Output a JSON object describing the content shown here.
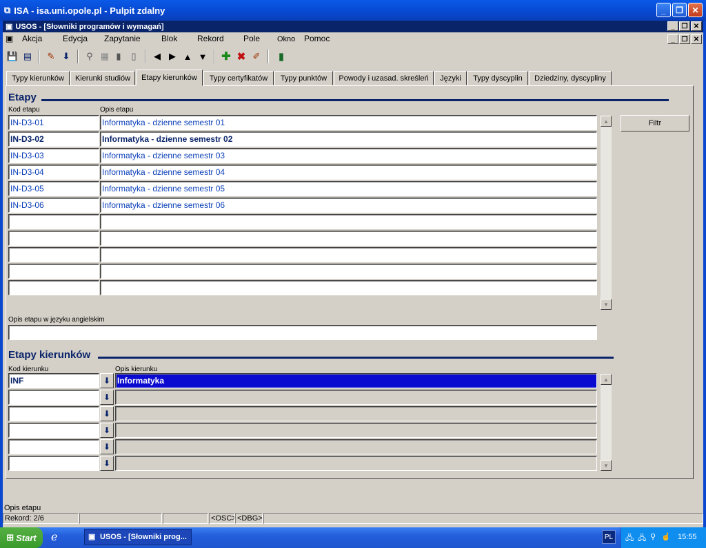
{
  "outer_window": {
    "title": "ISA - isa.uni.opole.pl - Pulpit zdalny"
  },
  "inner_window": {
    "title": "USOS - [Słowniki programów i wymagań]"
  },
  "menu": [
    "Akcja",
    "Edycja",
    "Zapytanie",
    "Blok",
    "Rekord",
    "Pole",
    "Okno",
    "Pomoc"
  ],
  "tabs": [
    "Typy kierunków",
    "Kierunki studiów",
    "Etapy kierunków",
    "Typy certyfikatów",
    "Typy punktów",
    "Powody i uzasad. skreśleń",
    "Języki",
    "Typy dyscyplin",
    "Dziedziny, dyscypliny"
  ],
  "active_tab": "Etapy kierunków",
  "etapy": {
    "section_title": "Etapy",
    "col_kod": "Kod etapu",
    "col_opis": "Opis etapu",
    "rows": [
      {
        "kod": "IN-D3-01",
        "opis": "Informatyka - dzienne semestr 01"
      },
      {
        "kod": "IN-D3-02",
        "opis": "Informatyka - dzienne semestr 02"
      },
      {
        "kod": "IN-D3-03",
        "opis": "Informatyka - dzienne semestr 03"
      },
      {
        "kod": "IN-D3-04",
        "opis": "Informatyka - dzienne semestr 04"
      },
      {
        "kod": "IN-D3-05",
        "opis": "Informatyka - dzienne semestr 05"
      },
      {
        "kod": "IN-D3-06",
        "opis": "Informatyka - dzienne semestr 06"
      },
      {
        "kod": "",
        "opis": ""
      },
      {
        "kod": "",
        "opis": ""
      },
      {
        "kod": "",
        "opis": ""
      },
      {
        "kod": "",
        "opis": ""
      },
      {
        "kod": "",
        "opis": ""
      }
    ],
    "current_row": 2,
    "filter_button": "Filtr",
    "english_label": "Opis etapu w języku angielskim",
    "english_value": ""
  },
  "etapy_kierunkow": {
    "section_title": "Etapy kierunków",
    "col_kod": "Kod kierunku",
    "col_opis": "Opis kierunku",
    "rows": [
      {
        "kod": "INF",
        "opis": "Informatyka"
      },
      {
        "kod": "",
        "opis": ""
      },
      {
        "kod": "",
        "opis": ""
      },
      {
        "kod": "",
        "opis": ""
      },
      {
        "kod": "",
        "opis": ""
      },
      {
        "kod": "",
        "opis": ""
      }
    ]
  },
  "status": {
    "hint": "Opis etapu",
    "record": "Rekord: 2/6",
    "osc": "<OSC>",
    "dbg": "<DBG>"
  },
  "taskbar": {
    "start": "Start",
    "task": "USOS - [Słowniki prog...",
    "lang": "PL",
    "clock": "15:55"
  },
  "colors": {
    "accent": "#0a246a",
    "selection": "#0a0ad0",
    "xp_blue": "#0a48d0"
  }
}
